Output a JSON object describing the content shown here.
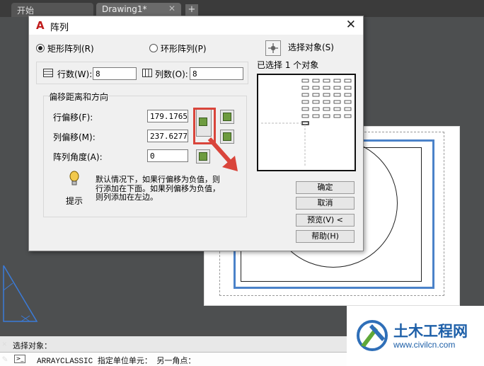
{
  "tabs": {
    "start": "开始",
    "drawing": "Drawing1*",
    "close": "✕",
    "add": "+"
  },
  "dialog": {
    "logo": "A",
    "title": "阵列",
    "close": "✕",
    "rect_array": "矩形阵列(R)",
    "polar_array": "环形阵列(P)",
    "select_objects": "选择对象(S)",
    "selected_count": "已选择 1 个对象",
    "rows_label": "行数(W):",
    "rows_value": "8",
    "cols_label": "列数(O):",
    "cols_value": "8",
    "offset_group": "偏移距离和方向",
    "row_offset_label": "行偏移(F):",
    "row_offset_value": "179.1765",
    "col_offset_label": "列偏移(M):",
    "col_offset_value": "237.6277",
    "angle_label": "阵列角度(A):",
    "angle_value": "0",
    "tip_label": "提示",
    "tip_text1": "默认情况下，如果行偏移为负值，则",
    "tip_text2": "行添加在下面。如果列偏移为负值，",
    "tip_text3": "则列添加在左边。",
    "ok": "确定",
    "cancel": "取消",
    "preview": "预览(V) <",
    "help": "帮助(H)"
  },
  "command": {
    "prompt": "选择对象：",
    "command_line": "ARRAYCLASSIC 指定单位单元： 另一角点："
  },
  "watermark": {
    "title": "土木工程网",
    "url": "www.civilcn.com"
  },
  "colors": {
    "highlight_red": "#d9453b",
    "highlight_blue": "#4b82c9"
  }
}
